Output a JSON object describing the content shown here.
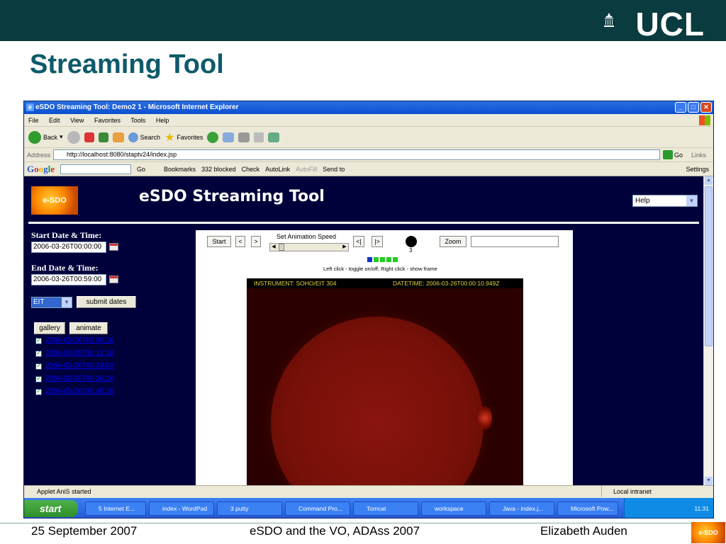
{
  "slide": {
    "brand": "UCL",
    "title": "Streaming Tool",
    "footer_date": "25 September 2007",
    "footer_event": "eSDO and the VO, ADAss 2007",
    "footer_author": "Elizabeth Auden",
    "footer_logo": "e-SDO"
  },
  "browser": {
    "window_title": "eSDO Streaming Tool: Demo2 1 - Microsoft Internet Explorer",
    "menu": [
      "File",
      "Edit",
      "View",
      "Favorites",
      "Tools",
      "Help"
    ],
    "toolbar": {
      "back": "Back",
      "search": "Search",
      "favorites": "Favorites"
    },
    "address_label": "Address",
    "address_value": "http://localhost:8080/staptv24/index.jsp",
    "go_label": "Go",
    "links_label": "Links",
    "google": {
      "logo": "Google",
      "go": "Go",
      "bookmarks": "Bookmarks",
      "blocked": "332 blocked",
      "check": "Check",
      "autolink": "AutoLink",
      "autofill": "AutoFill",
      "sendto": "Send to",
      "settings": "Settings"
    },
    "status_text": "Applet AniS started",
    "status_zone": "Local intranet"
  },
  "page": {
    "logo_text": "e-SDO",
    "title": "eSDO Streaming Tool",
    "help_select": "Help",
    "start_label": "Start Date & Time:",
    "start_value": "2006-03-26T00:00:00",
    "end_label": "End Date & Time:",
    "end_value": "2006-03-26T00:59:00",
    "instrument_select": "EIT",
    "submit_label": "submit dates",
    "gallery_label": "gallery",
    "animate_label": "animate",
    "frames": [
      "2006-03-26T00:00:10",
      "2006-03-26T00:12:10",
      "2006-03-26T00:24:03",
      "2006-03-26T00:36:10",
      "2006-03-26T00:48:10"
    ]
  },
  "applet": {
    "start_label": "Start",
    "prev_label": "<",
    "next_label": ">",
    "speed_label": "Set Animation Speed",
    "first_label": "<|",
    "last_label": "|>",
    "clock_value": "3",
    "zoom_label": "Zoom",
    "hint": "Left click - toggle on/off; Right click - show frame",
    "frame_colors": [
      "#1030d0",
      "#22cc22",
      "#22cc22",
      "#22cc22",
      "#22cc22"
    ],
    "instrument": "INSTRUMENT:  SOHO/EIT 304",
    "datetime": "DATETIME:  2006-03-26T00:00:10.949Z"
  },
  "taskbar": {
    "start": "start",
    "tasks": [
      "5 Internet E...",
      "index - WordPad",
      "3 putty",
      "Command Pro...",
      "Tomcat",
      "workspace",
      "Java - index.j...",
      "Microsoft Pow..."
    ],
    "clock": "11:31"
  }
}
